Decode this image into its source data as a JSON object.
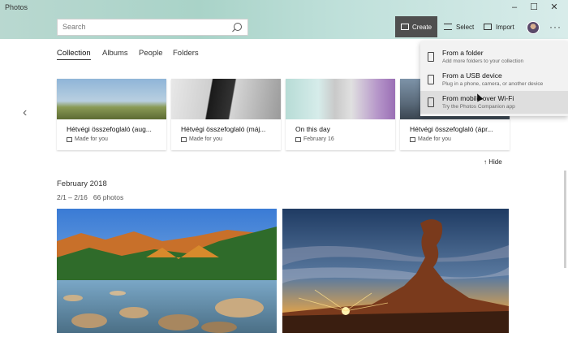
{
  "app": {
    "title": "Photos"
  },
  "window": {
    "minimize": "–",
    "maximize": "☐",
    "close": "✕"
  },
  "search": {
    "placeholder": "Search"
  },
  "toolbar": {
    "create": "Create",
    "select": "Select",
    "import": "Import",
    "more": "···"
  },
  "nav": {
    "tabs": [
      "Collection",
      "Albums",
      "People",
      "Folders"
    ],
    "active": "Collection"
  },
  "cards": [
    {
      "title": "Hétvégi összefoglaló (aug...",
      "sub": "Made for you"
    },
    {
      "title": "Hétvégi összefoglaló (máj...",
      "sub": "Made for you"
    },
    {
      "title": "On this day",
      "sub": "February 16"
    },
    {
      "title": "Hétvégi összefoglaló (ápr...",
      "sub": "Made for you"
    }
  ],
  "carousel": {
    "prev": "‹",
    "next": "›"
  },
  "hide_label": "Hide",
  "section": {
    "month": "February 2018",
    "range": "2/1 – 2/16",
    "count": "66 photos"
  },
  "menu": {
    "items": [
      {
        "title": "From a folder",
        "sub": "Add more folders to your collection"
      },
      {
        "title": "From a USB device",
        "sub": "Plug in a phone, camera, or another device"
      },
      {
        "title": "From mobile over Wi-Fi",
        "sub": "Try the Photos Companion app"
      }
    ]
  }
}
